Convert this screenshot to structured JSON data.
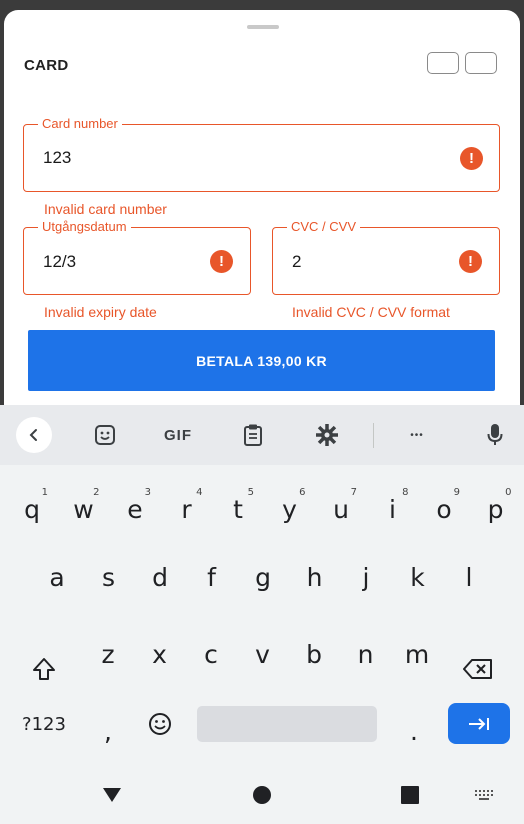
{
  "sheet": {
    "title": "CARD"
  },
  "form": {
    "card_number": {
      "label": "Card number",
      "value": "123",
      "error": "Invalid card number"
    },
    "expiry": {
      "label": "Utgångsdatum",
      "value": "12/3",
      "error": "Invalid expiry date"
    },
    "cvc": {
      "label": "CVC / CVV",
      "value": "2",
      "error": "Invalid CVC / CVV format"
    },
    "error_icon_glyph": "!"
  },
  "pay_button": {
    "label": "BETALA 139,00 KR"
  },
  "colors": {
    "error": "#e8562a",
    "primary": "#1e73e8"
  },
  "keyboard": {
    "toolbar": {
      "gif_label": "GIF",
      "more_label": "•••"
    },
    "row1": [
      {
        "char": "q",
        "hint": "1"
      },
      {
        "char": "w",
        "hint": "2"
      },
      {
        "char": "e",
        "hint": "3"
      },
      {
        "char": "r",
        "hint": "4"
      },
      {
        "char": "t",
        "hint": "5"
      },
      {
        "char": "y",
        "hint": "6"
      },
      {
        "char": "u",
        "hint": "7"
      },
      {
        "char": "i",
        "hint": "8"
      },
      {
        "char": "o",
        "hint": "9"
      },
      {
        "char": "p",
        "hint": "0"
      }
    ],
    "row2": [
      "a",
      "s",
      "d",
      "f",
      "g",
      "h",
      "j",
      "k",
      "l"
    ],
    "row3": [
      "z",
      "x",
      "c",
      "v",
      "b",
      "n",
      "m"
    ],
    "symbols_label": "?123",
    "comma": ",",
    "period": "."
  }
}
